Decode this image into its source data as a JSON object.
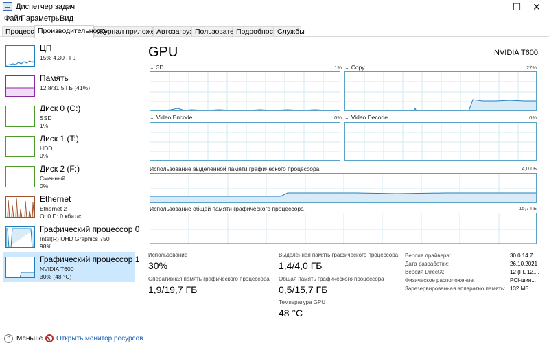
{
  "window": {
    "title": "Диспетчер задач",
    "minimize_glyph": "—",
    "maximize_glyph": "☐",
    "close_glyph": "✕"
  },
  "menu": [
    "Файл",
    "Параметры",
    "Вид"
  ],
  "tabs": [
    "Процессы",
    "Производительность",
    "Журнал приложений",
    "Автозагрузка",
    "Пользователи",
    "Подробности",
    "Службы"
  ],
  "active_tab": "Производительность",
  "sidebar": {
    "items": [
      {
        "name": "ЦП",
        "line1": "15% 4,30 ГГц",
        "line2": "",
        "icon": "cpu-graph-icon",
        "color": "#1e7fbf"
      },
      {
        "name": "Память",
        "line1": "12,8/31,5 ГБ (41%)",
        "line2": "",
        "icon": "memory-graph-icon",
        "color": "#8b2a9e"
      },
      {
        "name": "Диск 0 (C:)",
        "line1": "SSD",
        "line2": "1%",
        "icon": "disk-graph-icon",
        "color": "#4c9a2a"
      },
      {
        "name": "Диск 1 (T:)",
        "line1": "HDD",
        "line2": "0%",
        "icon": "disk-graph-icon",
        "color": "#4c9a2a"
      },
      {
        "name": "Диск 2 (F:)",
        "line1": "Сменный",
        "line2": "0%",
        "icon": "disk-graph-icon",
        "color": "#4c9a2a"
      },
      {
        "name": "Ethernet",
        "line1": "Ethernet 2",
        "line2": "О: 0 П: 0 кбит/с",
        "icon": "network-graph-icon",
        "color": "#a0522d"
      },
      {
        "name": "Графический процессор 0",
        "line1": "Intel(R) UHD Graphics 750",
        "line2": "98%",
        "icon": "gpu-graph-icon",
        "color": "#1e7fbf"
      },
      {
        "name": "Графический процессор 1",
        "line1": "NVIDIA T600",
        "line2": "30% (48 °C)",
        "icon": "gpu-graph-icon",
        "color": "#1e7fbf"
      }
    ],
    "selected_index": 7
  },
  "main": {
    "title": "GPU",
    "model": "NVIDIA T600",
    "engines": [
      {
        "label": "3D",
        "value": "1%"
      },
      {
        "label": "Copy",
        "value": "27%"
      },
      {
        "label": "Video Encode",
        "value": "0%"
      },
      {
        "label": "Video Decode",
        "value": "0%"
      }
    ],
    "dedicated_mem": {
      "label": "Использование выделенной памяти графического процессора",
      "value": "4,0 ГБ"
    },
    "shared_mem": {
      "label": "Использование общей памяти графического процессора",
      "value": "15,7 ГБ"
    },
    "stats": {
      "utilization": {
        "label": "Использование",
        "value": "30%"
      },
      "gpu_memory": {
        "label": "Оперативная память графического процессора",
        "value": "1,9/19,7 ГБ"
      },
      "dedicated": {
        "label": "Выделенная память графического процессора",
        "value": "1,4/4,0 ГБ"
      },
      "shared": {
        "label": "Общая память графического процессора",
        "value": "0,5/15,7 ГБ"
      },
      "temperature": {
        "label": "Температура GPU",
        "value": "48 °C"
      }
    },
    "details": [
      {
        "key": "Версия драйвера:",
        "value": "30.0.14.7..."
      },
      {
        "key": "Дата разработки:",
        "value": "26.10.2021"
      },
      {
        "key": "Версия DirectX:",
        "value": "12 (FL 12...."
      },
      {
        "key": "Физическое расположение:",
        "value": "PCI-шин..."
      },
      {
        "key": "Зарезервированная аппаратно память:",
        "value": "132 МБ"
      }
    ]
  },
  "footer": {
    "fewer_label": "Меньше",
    "resmon_label": "Открыть монитор ресурсов"
  },
  "colors": {
    "gpu_line": "#1e7fbf",
    "graph_border": "#5aa3c8",
    "grid": "#d6e8f2",
    "selected_bg": "#cce8ff"
  }
}
